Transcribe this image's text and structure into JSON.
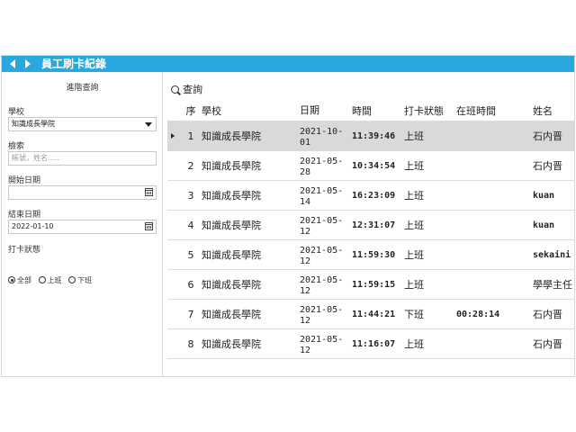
{
  "window": {
    "title": "員工刷卡紀錄"
  },
  "filters": {
    "heading": "進階查詢",
    "school_label": "學校",
    "school_value": "知識成長學院",
    "search_label": "檢索",
    "search_placeholder": "帳號，姓名.....",
    "start_label": "開始日期",
    "start_value": "",
    "end_label": "結束日期",
    "end_value": "2022-01-10",
    "state_label": "打卡狀態",
    "state_options": [
      "全部",
      "上班",
      "下班"
    ],
    "state_selected": "全部"
  },
  "toolbar": {
    "query_label": "查詢"
  },
  "table": {
    "columns": [
      "序",
      "學校",
      "日期",
      "時間",
      "打卡狀態",
      "在班時間",
      "姓名"
    ],
    "rows": [
      {
        "seq": "1",
        "school": "知識成長學院",
        "date_a": "2021-10-",
        "date_b": "01",
        "time": "11:39:46",
        "state": "上班",
        "work": "",
        "name": "石内晋",
        "selected": true
      },
      {
        "seq": "2",
        "school": "知識成長學院",
        "date_a": "2021-05-",
        "date_b": "28",
        "time": "10:34:54",
        "state": "上班",
        "work": "",
        "name": "石内晋"
      },
      {
        "seq": "3",
        "school": "知識成長學院",
        "date_a": "2021-05-",
        "date_b": "14",
        "time": "16:23:09",
        "state": "上班",
        "work": "",
        "name": "kuan"
      },
      {
        "seq": "4",
        "school": "知識成長學院",
        "date_a": "2021-05-",
        "date_b": "12",
        "time": "12:31:07",
        "state": "上班",
        "work": "",
        "name": "kuan"
      },
      {
        "seq": "5",
        "school": "知識成長學院",
        "date_a": "2021-05-",
        "date_b": "12",
        "time": "11:59:30",
        "state": "上班",
        "work": "",
        "name": "sekaini"
      },
      {
        "seq": "6",
        "school": "知識成長學院",
        "date_a": "2021-05-",
        "date_b": "12",
        "time": "11:59:15",
        "state": "上班",
        "work": "",
        "name": "學學主任"
      },
      {
        "seq": "7",
        "school": "知識成長學院",
        "date_a": "2021-05-",
        "date_b": "12",
        "time": "11:44:21",
        "state": "下班",
        "work": "00:28:14",
        "name": "石内晋"
      },
      {
        "seq": "8",
        "school": "知識成長學院",
        "date_a": "2021-05-",
        "date_b": "12",
        "time": "11:16:07",
        "state": "上班",
        "work": "",
        "name": "石内晋"
      }
    ]
  }
}
